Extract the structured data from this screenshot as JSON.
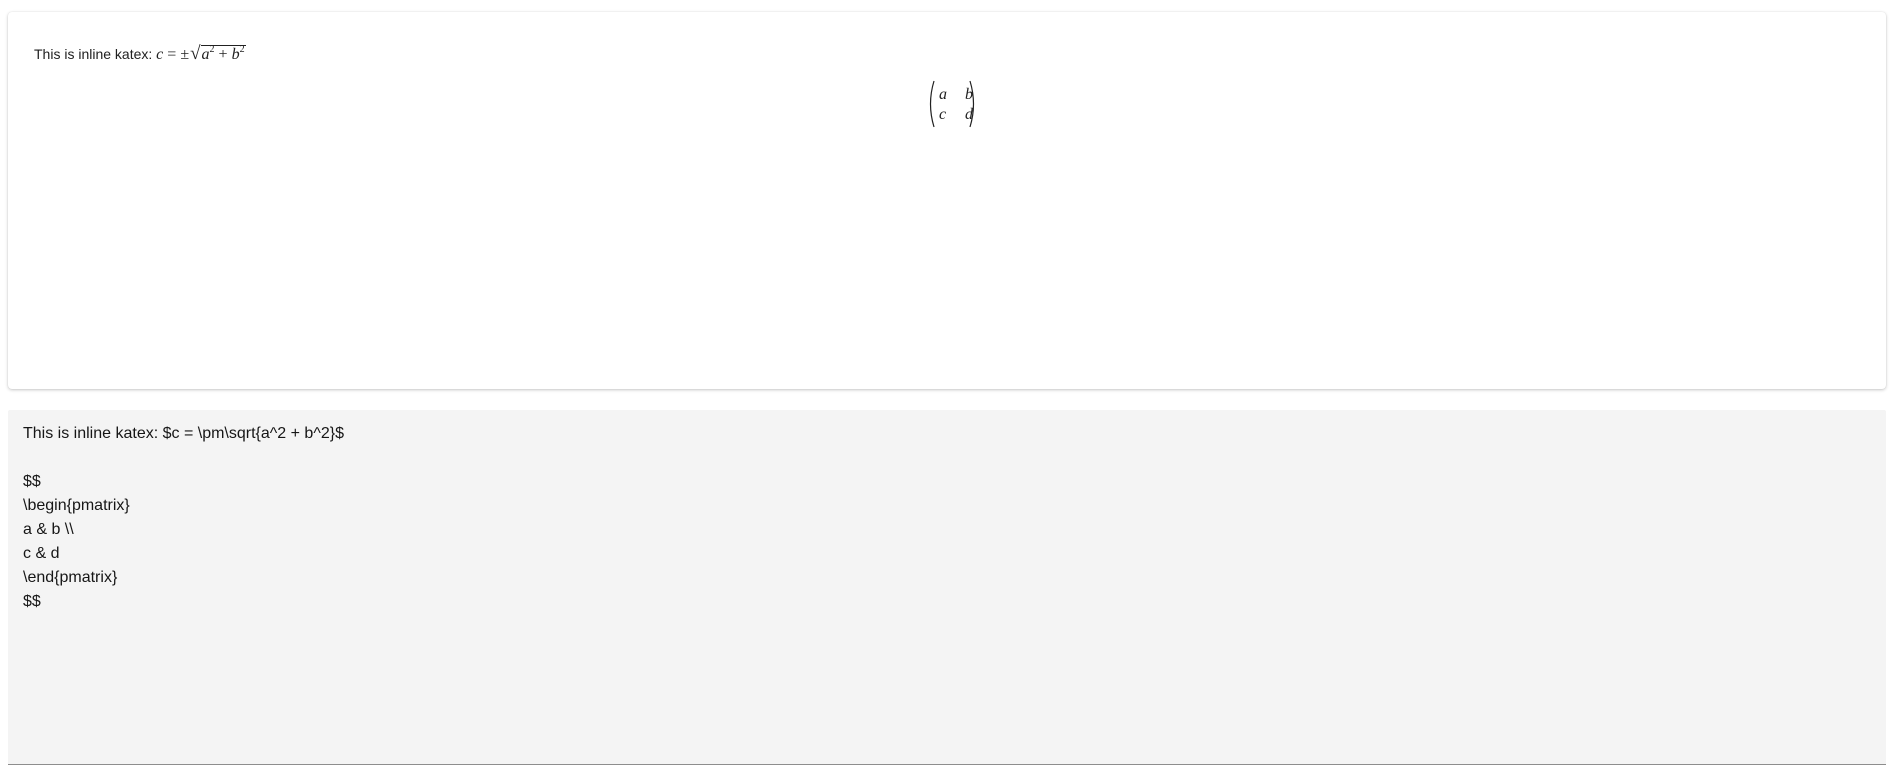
{
  "preview": {
    "inline_prefix": "This is inline katex:",
    "inline_math": {
      "c": "c",
      "equals": "=",
      "pm": "±",
      "a": "a",
      "plus": "+",
      "b": "b",
      "exp": "2"
    },
    "matrix": {
      "r1c1": "a",
      "r1c2": "b",
      "r2c1": "c",
      "r2c2": "d"
    }
  },
  "editor": {
    "lines": [
      "This is inline katex: $c = \\pm\\sqrt{a^2 + b^2}$",
      "",
      "$$",
      "\\begin{pmatrix}",
      "a & b \\\\",
      "c & d",
      "\\end{pmatrix}",
      "$$"
    ]
  }
}
